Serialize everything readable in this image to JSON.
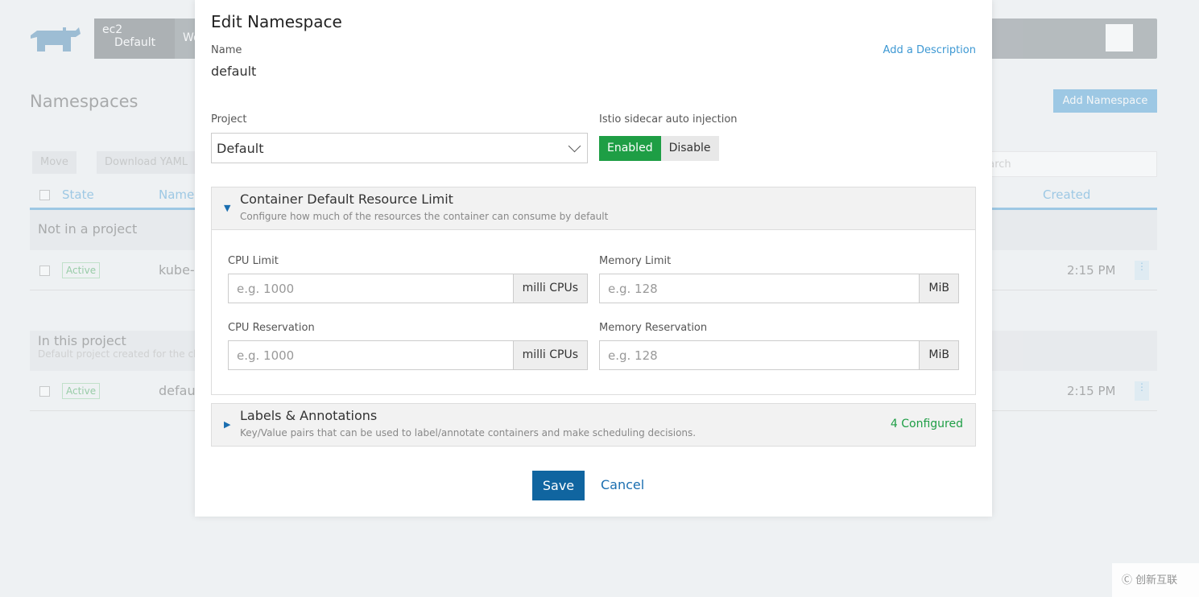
{
  "background": {
    "cluster": {
      "name": "ec2",
      "project": "Default"
    },
    "nav_partial": "Workloads",
    "page_title": "Namespaces",
    "add_button": "Add Namespace",
    "actions": [
      "Move",
      "Download YAML"
    ],
    "search_placeholder": "Search",
    "columns": [
      "State",
      "Name",
      "Created"
    ],
    "groups": [
      {
        "title": "Not in a project",
        "description": "",
        "rows": [
          {
            "state": "Active",
            "name": "kube-r",
            "created": "2:15 PM"
          }
        ]
      },
      {
        "title": "In this project",
        "description": "Default project created for the cl",
        "rows": [
          {
            "state": "Active",
            "name": "default",
            "created": "2:15 PM"
          }
        ]
      }
    ]
  },
  "modal": {
    "title": "Edit Namespace",
    "name_label": "Name",
    "name_value": "default",
    "add_description": "Add a Description",
    "project_label": "Project",
    "project_value": "Default",
    "istio_label": "Istio sidecar auto injection",
    "istio_options": [
      "Enabled",
      "Disable"
    ],
    "istio_selected": "Enabled",
    "resource_section": {
      "title": "Container Default Resource Limit",
      "description": "Configure how much of the resources the container can consume by default",
      "expanded": true
    },
    "cpu_limit": {
      "label": "CPU Limit",
      "placeholder": "e.g. 1000",
      "unit": "milli CPUs"
    },
    "memory_limit": {
      "label": "Memory Limit",
      "placeholder": "e.g. 128",
      "unit": "MiB"
    },
    "cpu_reservation": {
      "label": "CPU Reservation",
      "placeholder": "e.g. 1000",
      "unit": "milli CPUs"
    },
    "memory_reservation": {
      "label": "Memory Reservation",
      "placeholder": "e.g. 128",
      "unit": "MiB"
    },
    "labels_section": {
      "title": "Labels & Annotations",
      "description": "Key/Value pairs that can be used to label/annotate containers and make scheduling decisions.",
      "status": "4 Configured",
      "expanded": false
    },
    "save": "Save",
    "cancel": "Cancel"
  },
  "watermark": "创新互联",
  "colors": {
    "primary": "#1065a0",
    "success": "#1e9e45",
    "link": "#3d98d3"
  }
}
